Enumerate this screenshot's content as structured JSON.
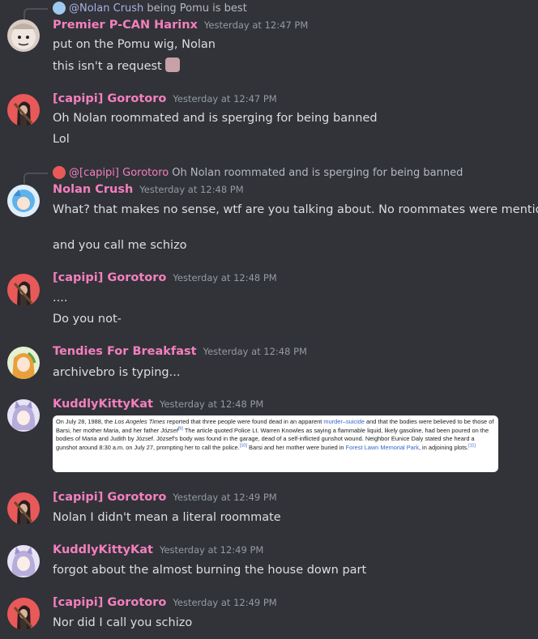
{
  "colors": {
    "background": "#313338",
    "username": "#f47fbe",
    "text": "#dbdee1",
    "timestamp": "#949ba4"
  },
  "messages": [
    {
      "reply": {
        "name": "@Nolan Crush",
        "text": "being Pomu is best"
      },
      "author": "Premier P-CAN Harinx",
      "timestamp": "Yesterday at 12:47 PM",
      "lines": [
        "put on the Pomu wig, Nolan",
        "this isn't a request"
      ]
    },
    {
      "author": "[capipi] Gorotoro",
      "timestamp": "Yesterday at 12:47 PM",
      "lines": [
        "Oh Nolan roommated and is sperging for being banned",
        "Lol"
      ]
    },
    {
      "reply": {
        "name": "@[capipi] Gorotoro",
        "text": "Oh Nolan roommated and is sperging for being banned"
      },
      "author": "Nolan Crush",
      "timestamp": "Yesterday at 12:48 PM",
      "lines": [
        "What? that makes no sense, wtf are you talking about. No roommates were mentioned",
        "and you call me schizo"
      ]
    },
    {
      "author": "[capipi] Gorotoro",
      "timestamp": "Yesterday at 12:48 PM",
      "lines": [
        "....",
        "Do you not-"
      ]
    },
    {
      "author": "Tendies For Breakfast",
      "timestamp": "Yesterday at 12:48 PM",
      "lines": [
        "archivebro is typing..."
      ]
    },
    {
      "author": "KuddlyKittyKat",
      "timestamp": "Yesterday at 12:48 PM",
      "embed": {
        "t1": "On July 28, 1988, the ",
        "t2": "Los Angeles Times",
        "t3": " reported that three people were found dead in an apparent ",
        "link1": "murder–suicide",
        "t4": " and that the bodies were believed to be those of Barsi, her mother Maria, and her father ",
        "t5": "József",
        "ref1": "[9]",
        "t6": " The article quoted Police Lt. Warren Knowles as saying a flammable liquid, likely gasoline, had been poured on the bodies of Maria and Judith by József. József's body was found in the garage, dead of a self-inflicted gunshot wound. Neighbor Eunice Daly stated she heard a gunshot around 8:30 a.m. on July 27, prompting her to call the police.",
        "ref2": "[10]",
        "t7": " Barsi and her mother were buried in ",
        "link2": "Forest Lawn Memorial Park",
        "t8": ", in adjoining plots.",
        "ref3": "[11]"
      }
    },
    {
      "author": "[capipi] Gorotoro",
      "timestamp": "Yesterday at 12:49 PM",
      "lines": [
        "Nolan I didn't mean a literal roommate"
      ]
    },
    {
      "author": "KuddlyKittyKat",
      "timestamp": "Yesterday at 12:49 PM",
      "lines": [
        "forgot about the almost burning the house down part"
      ]
    },
    {
      "author": "[capipi] Gorotoro",
      "timestamp": "Yesterday at 12:49 PM",
      "lines": [
        "Nor did I call you schizo"
      ]
    }
  ]
}
